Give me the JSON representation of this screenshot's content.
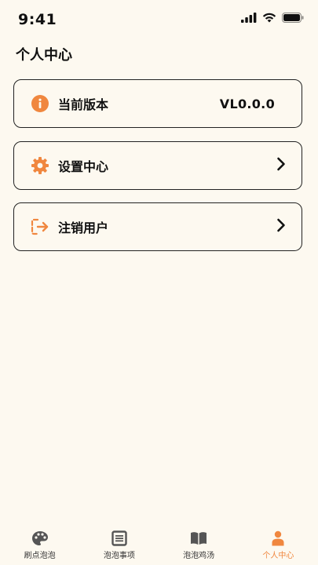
{
  "status_bar": {
    "time": "9:41"
  },
  "page": {
    "title": "个人中心"
  },
  "cards": {
    "version": {
      "label": "当前版本",
      "value": "VL0.0.0"
    },
    "settings": {
      "label": "设置中心"
    },
    "logout": {
      "label": "注销用户"
    }
  },
  "tabbar": {
    "tabs": [
      {
        "label": "刷点泡泡",
        "icon": "palette-icon"
      },
      {
        "label": "泡泡事项",
        "icon": "list-icon"
      },
      {
        "label": "泡泡鸡汤",
        "icon": "book-icon"
      },
      {
        "label": "个人中心",
        "icon": "person-icon",
        "active": true
      }
    ]
  },
  "colors": {
    "accent": "#f0873f",
    "background": "#fdf9f0",
    "border": "#222222"
  }
}
